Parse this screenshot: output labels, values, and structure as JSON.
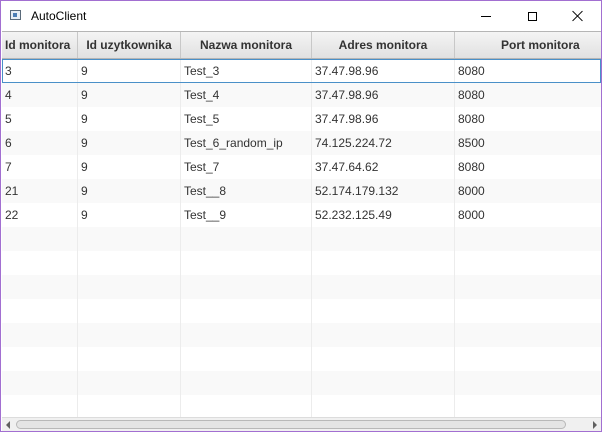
{
  "window": {
    "title": "AutoClient",
    "icon": "app-window-icon",
    "controls": [
      "minimize-icon",
      "maximize-icon",
      "close-icon"
    ]
  },
  "table": {
    "columns": [
      "Id monitora",
      "Id uzytkownika",
      "Nazwa monitora",
      "Adres monitora",
      "Port monitora"
    ],
    "rows": [
      [
        "3",
        "9",
        "Test_3",
        "37.47.98.96",
        "8080"
      ],
      [
        "4",
        "9",
        "Test_4",
        "37.47.98.96",
        "8080"
      ],
      [
        "5",
        "9",
        "Test_5",
        "37.47.98.96",
        "8080"
      ],
      [
        "6",
        "9",
        "Test_6_random_ip",
        "74.125.224.72",
        "8500"
      ],
      [
        "7",
        "9",
        "Test_7",
        "37.47.64.62",
        "8080"
      ],
      [
        "21",
        "9",
        "Test__8",
        "52.174.179.132",
        "8000"
      ],
      [
        "22",
        "9",
        "Test__9",
        "52.232.125.49",
        "8000"
      ]
    ],
    "selected_row": 0,
    "empty_rows": 8
  },
  "colors": {
    "window_border": "#a26fd1",
    "selection_outline": "#4a90c8",
    "row_alt": "#f9f9f9"
  }
}
